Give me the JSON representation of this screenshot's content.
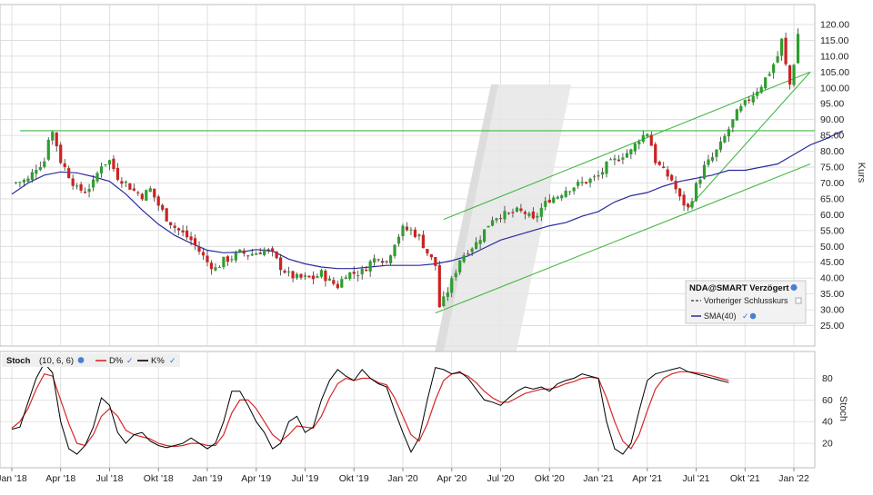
{
  "chart_data": [
    {
      "type": "candlestick",
      "instrument": "NDA@SMART",
      "yaxis_label": "Kurs",
      "ylim": [
        20,
        122
      ],
      "yticks": [
        "120.00",
        "115.00",
        "110.00",
        "105.00",
        "100.00",
        "95.00",
        "90.00",
        "85.00",
        "80.00",
        "75.00",
        "70.00",
        "65.00",
        "60.00",
        "55.00",
        "50.00",
        "45.00",
        "40.00",
        "35.00",
        "30.00",
        "25.00"
      ],
      "ytick_values": [
        120,
        115,
        110,
        105,
        100,
        95,
        90,
        85,
        80,
        75,
        70,
        65,
        60,
        55,
        50,
        45,
        40,
        35,
        30,
        25
      ],
      "x_start_month": 11.5,
      "x_end_month": 60.5,
      "legend": {
        "title": "NDA@SMART Verzögert",
        "prev_close": "Vorheriger Schlusskurs",
        "sma": "SMA(40)"
      },
      "sma_period": 40,
      "sma_points": [
        [
          0,
          66.5
        ],
        [
          1,
          70
        ],
        [
          2,
          72.5
        ],
        [
          3,
          73.5
        ],
        [
          4,
          73.2
        ],
        [
          5,
          72
        ],
        [
          6,
          70.5
        ],
        [
          7,
          66.5
        ],
        [
          8,
          61.5
        ],
        [
          9,
          57
        ],
        [
          10,
          53.5
        ],
        [
          11,
          51
        ],
        [
          12,
          48.8
        ],
        [
          13,
          48
        ],
        [
          14,
          48.2
        ],
        [
          15,
          49
        ],
        [
          16,
          48.5
        ],
        [
          17,
          46
        ],
        [
          18,
          44.5
        ],
        [
          19,
          43.5
        ],
        [
          20,
          43
        ],
        [
          21,
          43
        ],
        [
          22,
          43.5
        ],
        [
          23,
          44
        ],
        [
          24,
          44
        ],
        [
          25,
          44
        ],
        [
          26,
          44.5
        ],
        [
          27,
          45.5
        ],
        [
          28,
          47
        ],
        [
          29,
          49.5
        ],
        [
          30,
          52
        ],
        [
          31,
          53.5
        ],
        [
          32,
          55
        ],
        [
          33,
          56.5
        ],
        [
          34,
          57.5
        ],
        [
          35,
          59.5
        ],
        [
          36,
          61
        ],
        [
          37,
          64
        ],
        [
          38,
          66
        ],
        [
          39,
          67
        ],
        [
          40,
          69
        ],
        [
          41,
          70.5
        ],
        [
          42,
          71.5
        ],
        [
          43,
          72.5
        ],
        [
          44,
          74
        ],
        [
          45,
          74
        ],
        [
          46,
          75
        ],
        [
          47,
          76
        ],
        [
          48,
          79
        ],
        [
          49,
          82
        ],
        [
          50,
          84
        ],
        [
          51,
          86.5
        ]
      ],
      "candles": [
        [
          0,
          70
        ],
        [
          0.5,
          70.5
        ],
        [
          1,
          71
        ],
        [
          1.5,
          75
        ],
        [
          2,
          77
        ],
        [
          2.25,
          84.5
        ],
        [
          2.5,
          86
        ],
        [
          2.75,
          82
        ],
        [
          3,
          77
        ],
        [
          3.5,
          72.5
        ],
        [
          4,
          68
        ],
        [
          4.5,
          67.5
        ],
        [
          5,
          70
        ],
        [
          5.5,
          76
        ],
        [
          6,
          77
        ],
        [
          6.5,
          72
        ],
        [
          7,
          70
        ],
        [
          7.5,
          67.5
        ],
        [
          8,
          66
        ],
        [
          8.5,
          68
        ],
        [
          9,
          63
        ],
        [
          9.5,
          59
        ],
        [
          10,
          56
        ],
        [
          10.5,
          54
        ],
        [
          11,
          52
        ],
        [
          11.5,
          48.5
        ],
        [
          12,
          45
        ],
        [
          12.5,
          43
        ],
        [
          13,
          45.5
        ],
        [
          13.5,
          46.5
        ],
        [
          14,
          48
        ],
        [
          14.5,
          47.5
        ],
        [
          15,
          48
        ],
        [
          15.5,
          49
        ],
        [
          16,
          47.5
        ],
        [
          16.5,
          43.5
        ],
        [
          17,
          41
        ],
        [
          17.5,
          40
        ],
        [
          18,
          40
        ],
        [
          18.5,
          40
        ],
        [
          19,
          41.5
        ],
        [
          19.5,
          39
        ],
        [
          20,
          37.5
        ],
        [
          20.5,
          41.5
        ],
        [
          21,
          41.5
        ],
        [
          21.5,
          42
        ],
        [
          22,
          45
        ],
        [
          22.5,
          47
        ],
        [
          23,
          45
        ],
        [
          23.5,
          51.5
        ],
        [
          24,
          55.5
        ],
        [
          24.5,
          55
        ],
        [
          25,
          53
        ],
        [
          25.5,
          48
        ],
        [
          26,
          44
        ],
        [
          26.25,
          31
        ],
        [
          26.5,
          33
        ],
        [
          27,
          39
        ],
        [
          27.5,
          46
        ],
        [
          28,
          49
        ],
        [
          28.5,
          51
        ],
        [
          29,
          55
        ],
        [
          29.5,
          59
        ],
        [
          30,
          60
        ],
        [
          30.5,
          60
        ],
        [
          31,
          61
        ],
        [
          31.5,
          60.5
        ],
        [
          32,
          58
        ],
        [
          32.5,
          62
        ],
        [
          33,
          65
        ],
        [
          33.5,
          66
        ],
        [
          34,
          68
        ],
        [
          34.5,
          69
        ],
        [
          35,
          70
        ],
        [
          35.5,
          71
        ],
        [
          36,
          72
        ],
        [
          36.5,
          75.5
        ],
        [
          37,
          77
        ],
        [
          37.5,
          79
        ],
        [
          38,
          80
        ],
        [
          38.5,
          84
        ],
        [
          39,
          86
        ],
        [
          39.25,
          82
        ],
        [
          39.5,
          77
        ],
        [
          40,
          73.5
        ],
        [
          40.5,
          71
        ],
        [
          41,
          65
        ],
        [
          41.5,
          62
        ],
        [
          42,
          69
        ],
        [
          42.5,
          75
        ],
        [
          43,
          78
        ],
        [
          43.5,
          82
        ],
        [
          44,
          87
        ],
        [
          44.5,
          92
        ],
        [
          45,
          95
        ],
        [
          45.5,
          98
        ],
        [
          46,
          101
        ],
        [
          46.5,
          105
        ],
        [
          47,
          110
        ],
        [
          47.25,
          115
        ],
        [
          47.5,
          107
        ],
        [
          47.75,
          101
        ],
        [
          48,
          108
        ],
        [
          48.25,
          117
        ]
      ],
      "channel_upper": [
        [
          26.5,
          58.5
        ],
        [
          49,
          105
        ]
      ],
      "channel_lower": [
        [
          26,
          29
        ],
        [
          49,
          76
        ]
      ],
      "trend_line": [
        [
          41.5,
          62
        ],
        [
          49,
          105
        ]
      ],
      "resistance": 86.5
    },
    {
      "type": "line",
      "indicator": "Stoch",
      "params": "(10, 6, 6)",
      "series": [
        {
          "name": "D%",
          "color": "#d62728"
        },
        {
          "name": "K%",
          "color": "#000000"
        }
      ],
      "yaxis_label": "Stoch",
      "ylim": [
        0,
        98
      ],
      "yticks": [
        "80",
        "60",
        "40",
        "20"
      ],
      "ytick_values": [
        80,
        60,
        40,
        20
      ],
      "k_points": [
        [
          0,
          33
        ],
        [
          0.5,
          35
        ],
        [
          1,
          58
        ],
        [
          1.5,
          80
        ],
        [
          2,
          94
        ],
        [
          2.5,
          85
        ],
        [
          3,
          40
        ],
        [
          3.5,
          15
        ],
        [
          4,
          10
        ],
        [
          4.5,
          18
        ],
        [
          5,
          35
        ],
        [
          5.5,
          62
        ],
        [
          6,
          55
        ],
        [
          6.5,
          30
        ],
        [
          7,
          20
        ],
        [
          7.5,
          28
        ],
        [
          8,
          30
        ],
        [
          8.5,
          22
        ],
        [
          9,
          18
        ],
        [
          9.5,
          16
        ],
        [
          10,
          18
        ],
        [
          10.5,
          20
        ],
        [
          11,
          25
        ],
        [
          11.5,
          20
        ],
        [
          12,
          15
        ],
        [
          12.5,
          20
        ],
        [
          13,
          40
        ],
        [
          13.5,
          68
        ],
        [
          14,
          68
        ],
        [
          14.5,
          55
        ],
        [
          15,
          40
        ],
        [
          15.5,
          30
        ],
        [
          16,
          15
        ],
        [
          16.5,
          20
        ],
        [
          17,
          40
        ],
        [
          17.5,
          45
        ],
        [
          18,
          30
        ],
        [
          18.5,
          35
        ],
        [
          19,
          60
        ],
        [
          19.5,
          78
        ],
        [
          20,
          88
        ],
        [
          20.5,
          82
        ],
        [
          21,
          78
        ],
        [
          21.5,
          88
        ],
        [
          22,
          80
        ],
        [
          22.5,
          75
        ],
        [
          23,
          72
        ],
        [
          23.5,
          50
        ],
        [
          24,
          30
        ],
        [
          24.5,
          12
        ],
        [
          25,
          25
        ],
        [
          25.5,
          60
        ],
        [
          26,
          90
        ],
        [
          26.5,
          88
        ],
        [
          27,
          84
        ],
        [
          27.5,
          86
        ],
        [
          28,
          80
        ],
        [
          28.5,
          70
        ],
        [
          29,
          60
        ],
        [
          29.5,
          58
        ],
        [
          30,
          55
        ],
        [
          30.5,
          62
        ],
        [
          31,
          68
        ],
        [
          31.5,
          72
        ],
        [
          32,
          70
        ],
        [
          32.5,
          72
        ],
        [
          33,
          68
        ],
        [
          33.5,
          75
        ],
        [
          34,
          78
        ],
        [
          34.5,
          80
        ],
        [
          35,
          84
        ],
        [
          35.5,
          82
        ],
        [
          36,
          80
        ],
        [
          36.5,
          40
        ],
        [
          37,
          15
        ],
        [
          37.5,
          10
        ],
        [
          38,
          20
        ],
        [
          38.5,
          50
        ],
        [
          39,
          78
        ],
        [
          39.5,
          84
        ],
        [
          40,
          86
        ],
        [
          40.5,
          88
        ],
        [
          41,
          90
        ],
        [
          41.5,
          86
        ],
        [
          42,
          84
        ],
        [
          42.5,
          82
        ],
        [
          43,
          80
        ],
        [
          43.5,
          78
        ],
        [
          44,
          76
        ]
      ],
      "d_points": [
        [
          0,
          34
        ],
        [
          0.5,
          40
        ],
        [
          1,
          52
        ],
        [
          1.5,
          70
        ],
        [
          2,
          84
        ],
        [
          2.5,
          82
        ],
        [
          3,
          60
        ],
        [
          3.5,
          38
        ],
        [
          4,
          20
        ],
        [
          4.5,
          18
        ],
        [
          5,
          28
        ],
        [
          5.5,
          45
        ],
        [
          6,
          52
        ],
        [
          6.5,
          45
        ],
        [
          7,
          32
        ],
        [
          7.5,
          28
        ],
        [
          8,
          26
        ],
        [
          8.5,
          24
        ],
        [
          9,
          20
        ],
        [
          9.5,
          18
        ],
        [
          10,
          17
        ],
        [
          10.5,
          18
        ],
        [
          11,
          20
        ],
        [
          11.5,
          20
        ],
        [
          12,
          18
        ],
        [
          12.5,
          18
        ],
        [
          13,
          28
        ],
        [
          13.5,
          48
        ],
        [
          14,
          60
        ],
        [
          14.5,
          60
        ],
        [
          15,
          52
        ],
        [
          15.5,
          40
        ],
        [
          16,
          28
        ],
        [
          16.5,
          22
        ],
        [
          17,
          28
        ],
        [
          17.5,
          36
        ],
        [
          18,
          35
        ],
        [
          18.5,
          34
        ],
        [
          19,
          45
        ],
        [
          19.5,
          62
        ],
        [
          20,
          75
        ],
        [
          20.5,
          80
        ],
        [
          21,
          78
        ],
        [
          21.5,
          80
        ],
        [
          22,
          80
        ],
        [
          22.5,
          76
        ],
        [
          23,
          74
        ],
        [
          23.5,
          62
        ],
        [
          24,
          45
        ],
        [
          24.5,
          28
        ],
        [
          25,
          22
        ],
        [
          25.5,
          38
        ],
        [
          26,
          60
        ],
        [
          26.5,
          78
        ],
        [
          27,
          84
        ],
        [
          27.5,
          85
        ],
        [
          28,
          82
        ],
        [
          28.5,
          76
        ],
        [
          29,
          68
        ],
        [
          29.5,
          62
        ],
        [
          30,
          58
        ],
        [
          30.5,
          58
        ],
        [
          31,
          62
        ],
        [
          31.5,
          66
        ],
        [
          32,
          68
        ],
        [
          32.5,
          70
        ],
        [
          33,
          70
        ],
        [
          33.5,
          72
        ],
        [
          34,
          75
        ],
        [
          34.5,
          77
        ],
        [
          35,
          80
        ],
        [
          35.5,
          81
        ],
        [
          36,
          80
        ],
        [
          36.5,
          62
        ],
        [
          37,
          40
        ],
        [
          37.5,
          22
        ],
        [
          38,
          15
        ],
        [
          38.5,
          28
        ],
        [
          39,
          50
        ],
        [
          39.5,
          70
        ],
        [
          40,
          80
        ],
        [
          40.5,
          84
        ],
        [
          41,
          86
        ],
        [
          41.5,
          86
        ],
        [
          42,
          85
        ],
        [
          42.5,
          84
        ],
        [
          43,
          82
        ],
        [
          43.5,
          80
        ],
        [
          44,
          78
        ]
      ]
    }
  ],
  "x_axis": {
    "labels": [
      "Jan '18",
      "Apr '18",
      "Jul '18",
      "Okt '18",
      "Jan '19",
      "Apr '19",
      "Jul '19",
      "Okt '19",
      "Jan '20",
      "Apr '20",
      "Jul '20",
      "Okt '20",
      "Jan '21",
      "Apr '21",
      "Jul '21",
      "Okt '21",
      "Jan '22"
    ],
    "label_months": [
      12,
      15,
      18,
      21,
      24,
      27,
      30,
      33,
      36,
      39,
      42,
      45,
      48,
      51,
      54,
      57,
      60
    ]
  },
  "colors": {
    "up": "#2e9e2e",
    "down": "#cc2222",
    "sma": "#2b2b9c",
    "channel": "#43b843",
    "resistance": "#43b843",
    "grid": "#d9d9d9",
    "d_line": "#d62728",
    "k_line": "#000000"
  }
}
